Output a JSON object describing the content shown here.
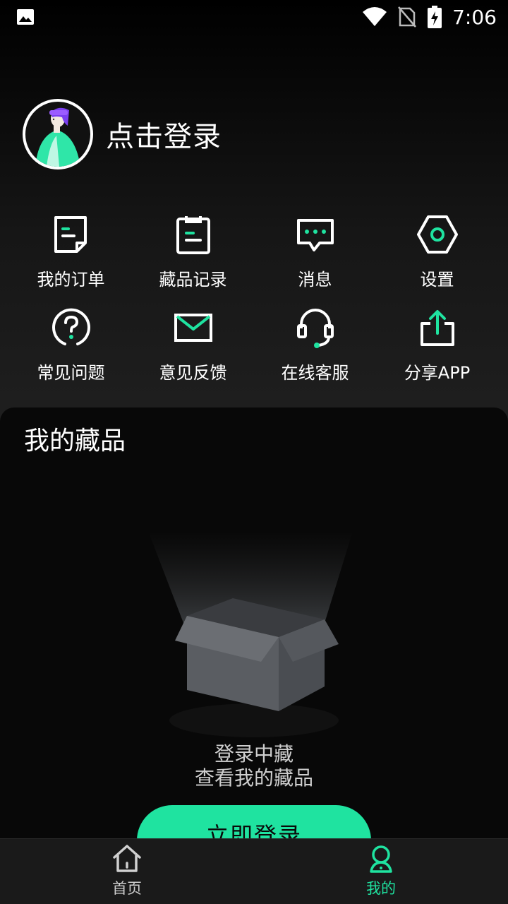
{
  "status_bar": {
    "time": "7:06",
    "icons": [
      "image-icon",
      "wifi-icon",
      "no-sim-icon",
      "battery-charging-icon"
    ]
  },
  "profile": {
    "login_prompt": "点击登录",
    "avatar_icon": "avatar-illustration"
  },
  "menu": [
    {
      "label": "我的订单",
      "icon": "order-icon"
    },
    {
      "label": "藏品记录",
      "icon": "clipboard-icon"
    },
    {
      "label": "消息",
      "icon": "message-icon"
    },
    {
      "label": "设置",
      "icon": "settings-icon"
    },
    {
      "label": "常见问题",
      "icon": "help-icon"
    },
    {
      "label": "意见反馈",
      "icon": "mail-icon"
    },
    {
      "label": "在线客服",
      "icon": "headset-icon"
    },
    {
      "label": "分享APP",
      "icon": "share-icon"
    }
  ],
  "collection": {
    "title": "我的藏品",
    "empty_line1": "登录中藏",
    "empty_line2": "查看我的藏品",
    "login_button": "立即登录"
  },
  "bottom_nav": [
    {
      "label": "首页",
      "icon": "home-icon",
      "active": false
    },
    {
      "label": "我的",
      "icon": "profile-icon",
      "active": true
    }
  ],
  "colors": {
    "accent": "#1fe3a0",
    "background": "#000000",
    "nav_background": "#1a1a1a"
  }
}
